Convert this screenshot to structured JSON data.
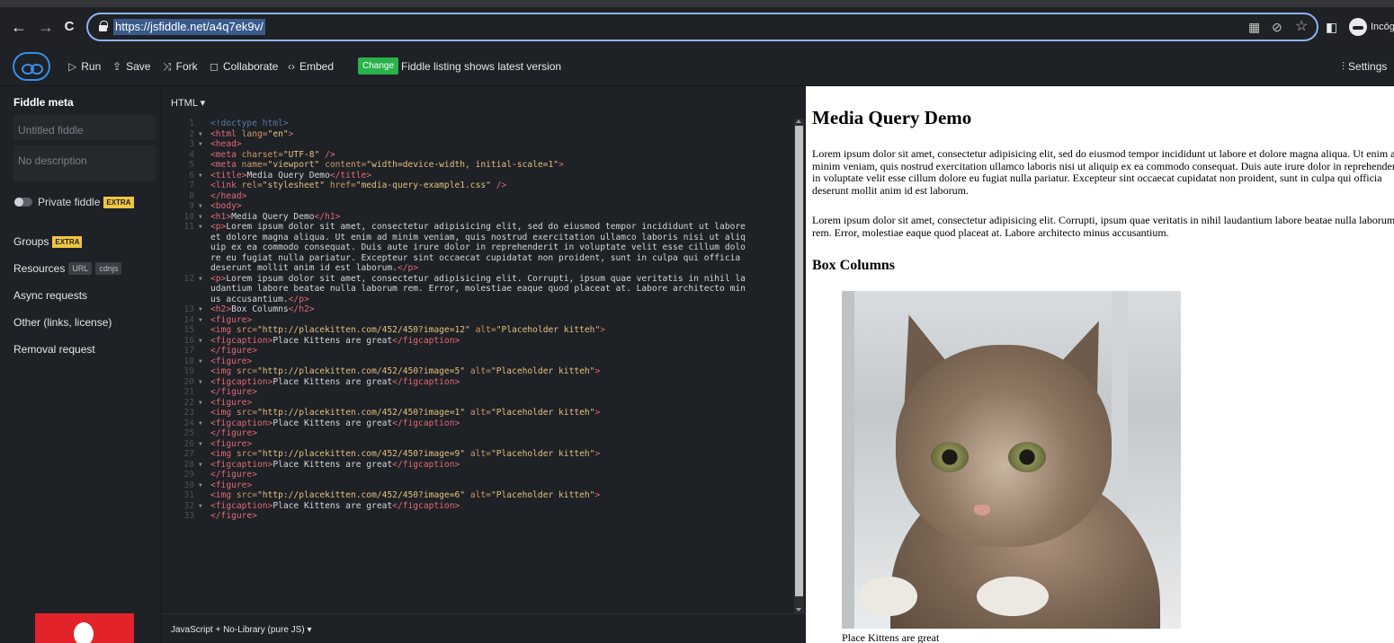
{
  "browser": {
    "url": "https://jsfiddle.net/a4q7ek9v/",
    "profile_label": "Incóg",
    "icons": [
      "back-arrow-icon",
      "forward-arrow-icon",
      "reload-icon",
      "lock-icon",
      "qr-code-icon",
      "eye-off-icon",
      "star-icon",
      "side-panel-icon",
      "incognito-icon"
    ],
    "back_glyph": "←",
    "forward_glyph": "→",
    "reload_glyph": "C",
    "qr_glyph": "▦",
    "eye_off_glyph": "⊘",
    "star_glyph": "☆",
    "panel_glyph": "◧"
  },
  "toolbar": {
    "run": "Run",
    "save": "Save",
    "fork": "Fork",
    "collaborate": "Collaborate",
    "embed": "Embed",
    "change_badge": "Change",
    "listing_text": "Fiddle listing shows latest version",
    "settings": "Settings",
    "run_glyph": "▷",
    "save_glyph": "⇪",
    "fork_glyph": "⤨",
    "collaborate_glyph": "◻",
    "embed_glyph": "‹›",
    "settings_glyph": "⫶"
  },
  "sidebar": {
    "title": "Fiddle meta",
    "title_placeholder": "Untitled fiddle",
    "description_placeholder": "No description",
    "private_label": "Private fiddle",
    "extra_badge": "EXTRA",
    "groups": "Groups",
    "resources": "Resources",
    "url_tag": "URL",
    "cdnjs_tag": "cdnjs",
    "async": "Async requests",
    "other": "Other (links, license)",
    "removal": "Removal request"
  },
  "editor": {
    "html_label": "HTML ▾",
    "js_label": "JavaScript + No-Library (pure JS) ▾",
    "lines": [
      {
        "n": "1",
        "fold": "",
        "t": [
          [
            "cm",
            "<!doctype html>"
          ]
        ]
      },
      {
        "n": "2",
        "fold": "▾",
        "t": [
          [
            "tg",
            "<html "
          ],
          [
            "at",
            "lang="
          ],
          [
            "st",
            "\"en\""
          ],
          [
            "tg",
            ">"
          ]
        ]
      },
      {
        "n": "3",
        "fold": "▾",
        "t": [
          [
            "tg",
            "<head>"
          ]
        ]
      },
      {
        "n": "4",
        "fold": "",
        "t": [
          [
            "tg",
            "<meta "
          ],
          [
            "at",
            "charset="
          ],
          [
            "st",
            "\"UTF-8\""
          ],
          [
            "tg",
            " />"
          ]
        ]
      },
      {
        "n": "5",
        "fold": "",
        "t": [
          [
            "tg",
            "<meta "
          ],
          [
            "at",
            "name="
          ],
          [
            "st",
            "\"viewport\""
          ],
          [
            "at",
            " content="
          ],
          [
            "st",
            "\"width=device-width, initial-scale=1\""
          ],
          [
            "tg",
            ">"
          ]
        ]
      },
      {
        "n": "6",
        "fold": "▾",
        "t": [
          [
            "tg",
            "<title>"
          ],
          [
            "tx",
            "Media Query Demo"
          ],
          [
            "tg",
            "</title>"
          ]
        ]
      },
      {
        "n": "7",
        "fold": "",
        "t": [
          [
            "tg",
            "<link "
          ],
          [
            "at",
            "rel="
          ],
          [
            "st",
            "\"stylesheet\""
          ],
          [
            "at",
            " href="
          ],
          [
            "st",
            "\"media-query-example1.css\""
          ],
          [
            "tg",
            " />"
          ]
        ]
      },
      {
        "n": "8",
        "fold": "",
        "t": [
          [
            "tg",
            "</head>"
          ]
        ]
      },
      {
        "n": "9",
        "fold": "▾",
        "t": [
          [
            "tg",
            "<body>"
          ]
        ]
      },
      {
        "n": "10",
        "fold": "▾",
        "t": [
          [
            "tg",
            "<h1>"
          ],
          [
            "tx",
            "Media Query Demo"
          ],
          [
            "tg",
            "</h1>"
          ]
        ]
      },
      {
        "n": "11",
        "fold": "▾",
        "t": [
          [
            "tg",
            "<p>"
          ],
          [
            "tx",
            "Lorem ipsum dolor sit amet, consectetur adipisicing elit, sed do eiusmod tempor incididunt ut labore"
          ]
        ]
      },
      {
        "n": "",
        "fold": "",
        "t": [
          [
            "tx",
            "et dolore magna aliqua. Ut enim ad minim veniam, quis nostrud exercitation ullamco laboris nisi ut aliq"
          ]
        ]
      },
      {
        "n": "",
        "fold": "",
        "t": [
          [
            "tx",
            "uip ex ea commodo consequat. Duis aute irure dolor in reprehenderit in voluptate velit esse cillum dolo"
          ]
        ]
      },
      {
        "n": "",
        "fold": "",
        "t": [
          [
            "tx",
            "re eu fugiat nulla pariatur. Excepteur sint occaecat cupidatat non proident, sunt in culpa qui officia"
          ]
        ]
      },
      {
        "n": "",
        "fold": "",
        "t": [
          [
            "tx",
            "deserunt mollit anim id est laborum."
          ],
          [
            "tg",
            "</p>"
          ]
        ]
      },
      {
        "n": "12",
        "fold": "▾",
        "t": [
          [
            "tg",
            "<p>"
          ],
          [
            "tx",
            "Lorem ipsum dolor sit amet, consectetur adipisicing elit. Corrupti, ipsum quae veritatis in nihil la"
          ]
        ]
      },
      {
        "n": "",
        "fold": "",
        "t": [
          [
            "tx",
            "udantium labore beatae nulla laborum rem. Error, molestiae eaque quod placeat at. Labore architecto min"
          ]
        ]
      },
      {
        "n": "",
        "fold": "",
        "t": [
          [
            "tx",
            "us accusantium."
          ],
          [
            "tg",
            "</p>"
          ]
        ]
      },
      {
        "n": "13",
        "fold": "▾",
        "t": [
          [
            "tg",
            "<h2>"
          ],
          [
            "tx",
            "Box Columns"
          ],
          [
            "tg",
            "</h2>"
          ]
        ]
      },
      {
        "n": "14",
        "fold": "▾",
        "t": [
          [
            "tg",
            "<figure>"
          ]
        ]
      },
      {
        "n": "15",
        "fold": "",
        "t": [
          [
            "tg",
            "<img "
          ],
          [
            "at",
            "src="
          ],
          [
            "st",
            "\"http://placekitten.com/452/450?image=12\""
          ],
          [
            "at",
            " alt="
          ],
          [
            "st",
            "\"Placeholder kitteh\""
          ],
          [
            "tg",
            ">"
          ]
        ]
      },
      {
        "n": "16",
        "fold": "▾",
        "t": [
          [
            "tg",
            "<figcaption>"
          ],
          [
            "tx",
            "Place Kittens are great"
          ],
          [
            "tg",
            "</figcaption>"
          ]
        ]
      },
      {
        "n": "17",
        "fold": "",
        "t": [
          [
            "tg",
            "</figure>"
          ]
        ]
      },
      {
        "n": "18",
        "fold": "▾",
        "t": [
          [
            "tg",
            "<figure>"
          ]
        ]
      },
      {
        "n": "19",
        "fold": "",
        "t": [
          [
            "tg",
            "<img "
          ],
          [
            "at",
            "src="
          ],
          [
            "st",
            "\"http://placekitten.com/452/450?image=5\""
          ],
          [
            "at",
            " alt="
          ],
          [
            "st",
            "\"Placeholder kitteh\""
          ],
          [
            "tg",
            ">"
          ]
        ]
      },
      {
        "n": "20",
        "fold": "▾",
        "t": [
          [
            "tg",
            "<figcaption>"
          ],
          [
            "tx",
            "Place Kittens are great"
          ],
          [
            "tg",
            "</figcaption>"
          ]
        ]
      },
      {
        "n": "21",
        "fold": "",
        "t": [
          [
            "tg",
            "</figure>"
          ]
        ]
      },
      {
        "n": "22",
        "fold": "▾",
        "t": [
          [
            "tg",
            "<figure>"
          ]
        ]
      },
      {
        "n": "23",
        "fold": "",
        "t": [
          [
            "tg",
            "<img "
          ],
          [
            "at",
            "src="
          ],
          [
            "st",
            "\"http://placekitten.com/452/450?image=1\""
          ],
          [
            "at",
            " alt="
          ],
          [
            "st",
            "\"Placeholder kitteh\""
          ],
          [
            "tg",
            ">"
          ]
        ]
      },
      {
        "n": "24",
        "fold": "▾",
        "t": [
          [
            "tg",
            "<figcaption>"
          ],
          [
            "tx",
            "Place Kittens are great"
          ],
          [
            "tg",
            "</figcaption>"
          ]
        ]
      },
      {
        "n": "25",
        "fold": "",
        "t": [
          [
            "tg",
            "</figure>"
          ]
        ]
      },
      {
        "n": "26",
        "fold": "▾",
        "t": [
          [
            "tg",
            "<figure>"
          ]
        ]
      },
      {
        "n": "27",
        "fold": "",
        "t": [
          [
            "tg",
            "<img "
          ],
          [
            "at",
            "src="
          ],
          [
            "st",
            "\"http://placekitten.com/452/450?image=9\""
          ],
          [
            "at",
            " alt="
          ],
          [
            "st",
            "\"Placeholder kitteh\""
          ],
          [
            "tg",
            ">"
          ]
        ]
      },
      {
        "n": "28",
        "fold": "▾",
        "t": [
          [
            "tg",
            "<figcaption>"
          ],
          [
            "tx",
            "Place Kittens are great"
          ],
          [
            "tg",
            "</figcaption>"
          ]
        ]
      },
      {
        "n": "29",
        "fold": "",
        "t": [
          [
            "tg",
            "</figure>"
          ]
        ]
      },
      {
        "n": "30",
        "fold": "▾",
        "t": [
          [
            "tg",
            "<figure>"
          ]
        ]
      },
      {
        "n": "31",
        "fold": "",
        "t": [
          [
            "tg",
            "<img "
          ],
          [
            "at",
            "src="
          ],
          [
            "st",
            "\"http://placekitten.com/452/450?image=6\""
          ],
          [
            "at",
            " alt="
          ],
          [
            "st",
            "\"Placeholder kitteh\""
          ],
          [
            "tg",
            ">"
          ]
        ]
      },
      {
        "n": "32",
        "fold": "▾",
        "t": [
          [
            "tg",
            "<figcaption>"
          ],
          [
            "tx",
            "Place Kittens are great"
          ],
          [
            "tg",
            "</figcaption>"
          ]
        ]
      },
      {
        "n": "33",
        "fold": "",
        "t": [
          [
            "tg",
            "</figure>"
          ]
        ]
      }
    ]
  },
  "result": {
    "h1": "Media Query Demo",
    "p1": "Lorem ipsum dolor sit amet, consectetur adipisicing elit, sed do eiusmod tempor incididunt ut labore et dolore magna aliqua. Ut enim ad minim veniam, quis nostrud exercitation ullamco laboris nisi ut aliquip ex ea commodo consequat. Duis aute irure dolor in reprehenderit in voluptate velit esse cillum dolore eu fugiat nulla pariatur. Excepteur sint occaecat cupidatat non proident, sunt in culpa qui officia deserunt mollit anim id est laborum.",
    "p2": "Lorem ipsum dolor sit amet, consectetur adipisicing elit. Corrupti, ipsum quae veritatis in nihil laudantium labore beatae nulla laborum rem. Error, molestiae eaque quod placeat at. Labore architecto minus accusantium.",
    "h2": "Box Columns",
    "caption": "Place Kittens are great"
  }
}
